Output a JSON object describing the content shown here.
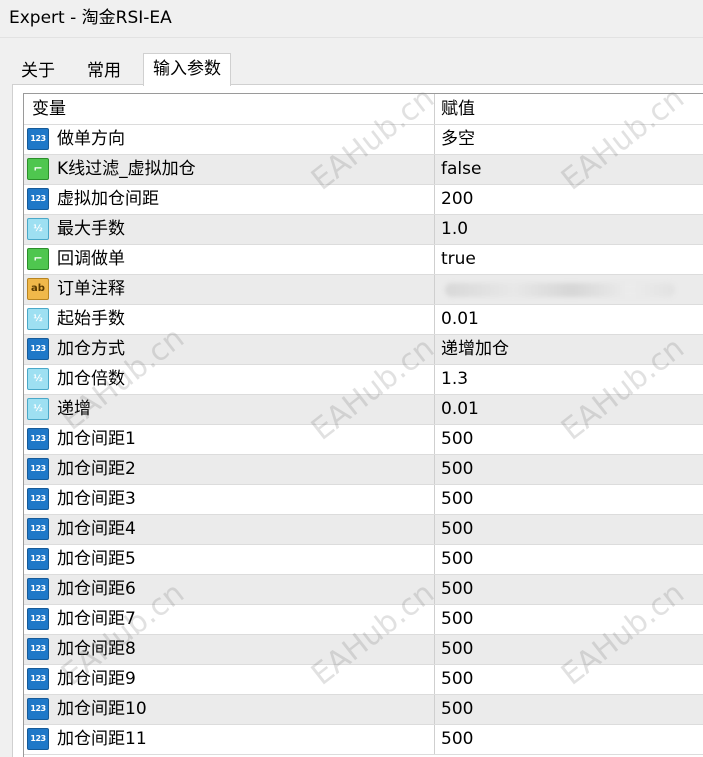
{
  "window": {
    "title": "Expert - 淘金RSI-EA"
  },
  "tabs": [
    {
      "label": "关于"
    },
    {
      "label": "常用"
    },
    {
      "label": "输入参数"
    }
  ],
  "table": {
    "headers": {
      "name": "变量",
      "value": "赋值"
    },
    "rows": [
      {
        "icon": "int-icon",
        "glyph": "123",
        "name": "做单方向",
        "value": "多空"
      },
      {
        "icon": "bool-icon",
        "glyph": "⌐",
        "name": "K线过滤_虚拟加仓",
        "value": "false"
      },
      {
        "icon": "int-icon",
        "glyph": "123",
        "name": "虚拟加仓间距",
        "value": "200"
      },
      {
        "icon": "double-icon",
        "glyph": "½",
        "name": "最大手数",
        "value": "1.0"
      },
      {
        "icon": "bool-icon",
        "glyph": "⌐",
        "name": "回调做单",
        "value": "true"
      },
      {
        "icon": "string-icon",
        "glyph": "ab",
        "name": "订单注释",
        "value": ""
      },
      {
        "icon": "double-icon",
        "glyph": "½",
        "name": "起始手数",
        "value": "0.01"
      },
      {
        "icon": "int-icon",
        "glyph": "123",
        "name": "加仓方式",
        "value": "递增加仓"
      },
      {
        "icon": "double-icon",
        "glyph": "½",
        "name": "加仓倍数",
        "value": "1.3"
      },
      {
        "icon": "double-icon",
        "glyph": "½",
        "name": "递增",
        "value": "0.01"
      },
      {
        "icon": "int-icon",
        "glyph": "123",
        "name": "加仓间距1",
        "value": "500"
      },
      {
        "icon": "int-icon",
        "glyph": "123",
        "name": "加仓间距2",
        "value": "500"
      },
      {
        "icon": "int-icon",
        "glyph": "123",
        "name": "加仓间距3",
        "value": "500"
      },
      {
        "icon": "int-icon",
        "glyph": "123",
        "name": "加仓间距4",
        "value": "500"
      },
      {
        "icon": "int-icon",
        "glyph": "123",
        "name": "加仓间距5",
        "value": "500"
      },
      {
        "icon": "int-icon",
        "glyph": "123",
        "name": "加仓间距6",
        "value": "500"
      },
      {
        "icon": "int-icon",
        "glyph": "123",
        "name": "加仓间距7",
        "value": "500"
      },
      {
        "icon": "int-icon",
        "glyph": "123",
        "name": "加仓间距8",
        "value": "500"
      },
      {
        "icon": "int-icon",
        "glyph": "123",
        "name": "加仓间距9",
        "value": "500"
      },
      {
        "icon": "int-icon",
        "glyph": "123",
        "name": "加仓间距10",
        "value": "500"
      },
      {
        "icon": "int-icon",
        "glyph": "123",
        "name": "加仓间距11",
        "value": "500"
      }
    ]
  },
  "watermark": {
    "text": "EAHub.cn"
  }
}
